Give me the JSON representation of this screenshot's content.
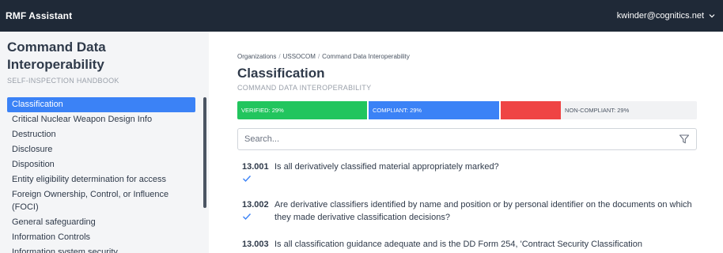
{
  "header": {
    "app_title": "RMF Assistant",
    "user_email": "kwinder@cognitics.net",
    "user_menu_icon": "chevron-down-icon"
  },
  "sidebar": {
    "title": "Command Data Interoperability",
    "subtitle": "SELF-INSPECTION HANDBOOK",
    "items": [
      {
        "label": "Classification",
        "active": true
      },
      {
        "label": "Critical Nuclear Weapon Design Info"
      },
      {
        "label": "Destruction"
      },
      {
        "label": "Disclosure"
      },
      {
        "label": "Disposition"
      },
      {
        "label": "Entity eligibility determination for access"
      },
      {
        "label": "Foreign Ownership, Control, or Influence (FOCI)"
      },
      {
        "label": "General safeguarding"
      },
      {
        "label": "Information Controls"
      },
      {
        "label": "Information system security"
      }
    ]
  },
  "main": {
    "breadcrumb": [
      "Organizations",
      "USSOCOM",
      "Command Data Interoperability"
    ],
    "title": "Classification",
    "subtitle": "COMMAND DATA INTEROPERABILITY",
    "progress": {
      "verified_label": "VERIFIED: 29%",
      "verified_pct": 29,
      "compliant_label": "COMPLIANT: 29%",
      "compliant_pct": 29,
      "noncompliant_label": "NON-COMPLIANT: 29%",
      "noncompliant_pct": 29,
      "colors": {
        "verified": "#22c55e",
        "compliant": "#3b82f6",
        "flagged": "#ef4444",
        "noncompliant": "#f1f2f4"
      }
    },
    "search": {
      "placeholder": "Search...",
      "value": "",
      "icon": "filter-icon"
    },
    "questions": [
      {
        "number": "13.001",
        "text": "Is all derivatively classified material appropriately marked?",
        "checked": true
      },
      {
        "number": "13.002",
        "text": "Are derivative classifiers identified by name and position or by personal identifier on the documents on which they made derivative classification decisions?",
        "checked": true
      },
      {
        "number": "13.003",
        "text": "Is all classification guidance adequate and is the DD Form 254, 'Contract Security Classification",
        "checked": false
      }
    ]
  }
}
